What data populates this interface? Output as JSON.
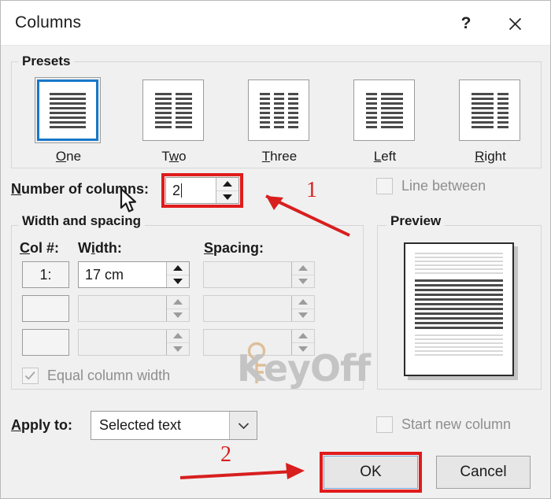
{
  "window": {
    "title": "Columns",
    "help_icon": "question-mark-icon",
    "close_icon": "close-icon"
  },
  "presets": {
    "group_label": "Presets",
    "selected": "One",
    "items": [
      {
        "label": "One",
        "accel": "O",
        "icon": "preset-one-column-icon"
      },
      {
        "label": "Two",
        "accel": "w",
        "icon": "preset-two-columns-icon"
      },
      {
        "label": "Three",
        "accel": "T",
        "icon": "preset-three-columns-icon"
      },
      {
        "label": "Left",
        "accel": "L",
        "icon": "preset-left-column-icon"
      },
      {
        "label": "Right",
        "accel": "R",
        "icon": "preset-right-column-icon"
      }
    ]
  },
  "number_of_columns": {
    "label": "Number of columns:",
    "accel": "N",
    "value": "2",
    "spinner_up_icon": "spinner-up-arrow-icon",
    "spinner_down_icon": "spinner-down-arrow-icon"
  },
  "line_between": {
    "label": "Line between",
    "checked": false,
    "enabled": false
  },
  "width_and_spacing": {
    "group_label": "Width and spacing",
    "headers": {
      "col": "Col #:",
      "col_accel": "C",
      "width": "Width:",
      "width_accel": "i",
      "spacing": "Spacing:",
      "spacing_accel": "S"
    },
    "rows": [
      {
        "col": "1:",
        "width": "17 cm",
        "spacing": "",
        "enabled": true
      },
      {
        "col": "",
        "width": "",
        "spacing": "",
        "enabled": false
      },
      {
        "col": "",
        "width": "",
        "spacing": "",
        "enabled": false
      }
    ],
    "equal_column_width": {
      "label": "Equal column width",
      "checked": true,
      "enabled": false
    }
  },
  "preview": {
    "group_label": "Preview",
    "top_lines": 6,
    "selected_lines": 11,
    "bottom_lines": 6
  },
  "apply_to": {
    "label": "Apply to:",
    "accel": "A",
    "value": "Selected text",
    "dropdown_icon": "chevron-down-icon"
  },
  "start_new_column": {
    "label": "Start new column",
    "checked": false,
    "enabled": false
  },
  "footer": {
    "ok_label": "OK",
    "cancel_label": "Cancel"
  },
  "annotations": {
    "step_one": "1",
    "step_two": "2",
    "color": "#d81e1e"
  },
  "watermark": {
    "text": "KeyOff",
    "icon": "key-icon",
    "color": "#c4c4c4"
  },
  "colors": {
    "dialog_background": "#f0f0f0",
    "titlebar_background": "#ffffff",
    "selection_blue": "#1878c8",
    "annotation_red": "#e01b1b"
  }
}
